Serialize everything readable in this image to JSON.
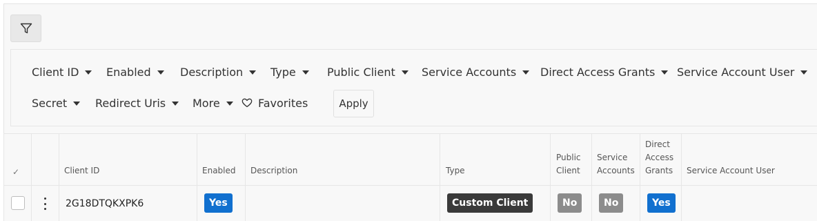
{
  "filters": {
    "client_id": "Client ID",
    "enabled": "Enabled",
    "description": "Description",
    "type": "Type",
    "public_client": "Public Client",
    "service_accounts": "Service Accounts",
    "direct_access_grants": "Direct Access Grants",
    "service_account_user": "Service Account User",
    "secret": "Secret",
    "redirect_uris": "Redirect Uris",
    "more": "More",
    "favorites": "Favorites",
    "apply": "Apply"
  },
  "table": {
    "headers": {
      "select_all": "✓",
      "client_id": "Client ID",
      "enabled": "Enabled",
      "description": "Description",
      "type": "Type",
      "public_client_1": "Public",
      "public_client_2": "Client",
      "service_accounts_1": "Service",
      "service_accounts_2": "Accounts",
      "direct_access_1": "Direct",
      "direct_access_2": "Access",
      "direct_access_3": "Grants",
      "service_account_user": "Service Account User"
    },
    "rows": [
      {
        "client_id": "2G18DTQKXPK6",
        "enabled": "Yes",
        "description": "",
        "type": "Custom Client",
        "public_client": "No",
        "service_accounts": "No",
        "direct_access_grants": "Yes",
        "service_account_user": ""
      }
    ]
  },
  "colors": {
    "yes_badge": "#1170cf",
    "no_badge": "#8c8c8c",
    "type_badge": "#3a3a3a"
  },
  "icons": {
    "filter": "funnel-icon",
    "favorites": "heart-outline-icon",
    "row_menu": "kebab-icon"
  }
}
